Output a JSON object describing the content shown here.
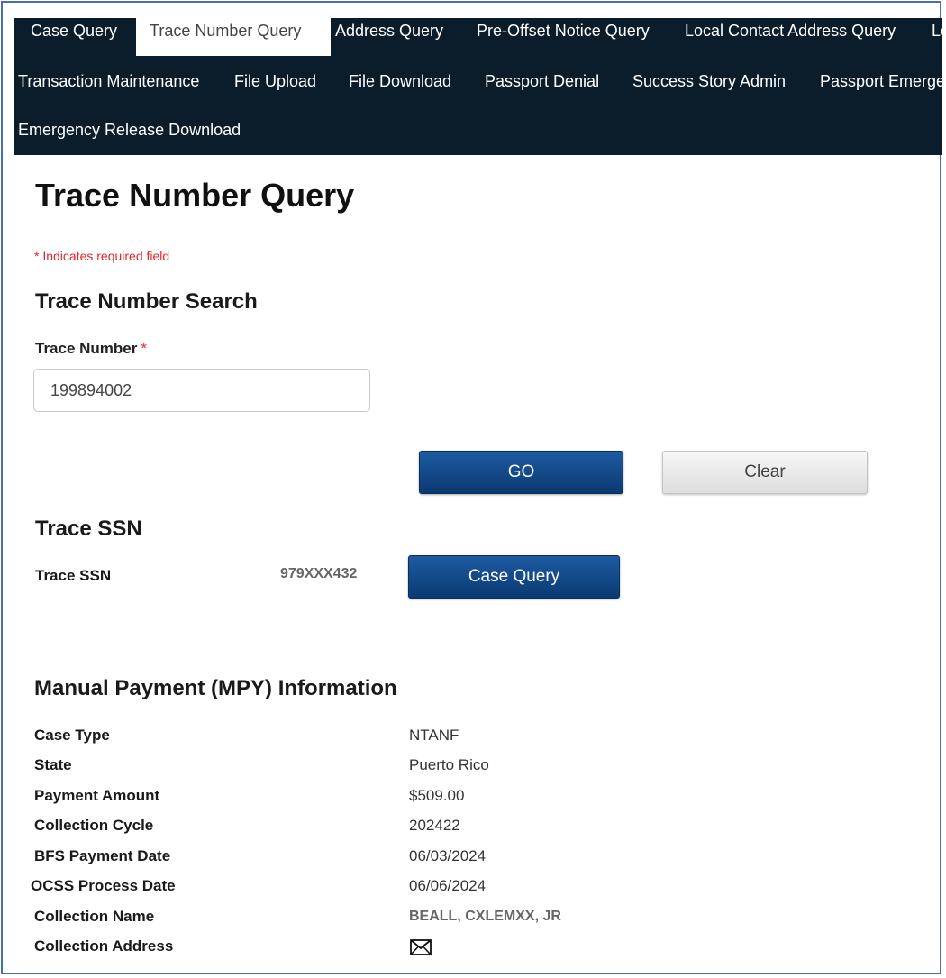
{
  "nav": {
    "row1": [
      "Case Query",
      "Trace Number Query",
      "Address Query",
      "Pre-Offset Notice Query",
      "Local Contact Address Query",
      "Lo"
    ],
    "row2": [
      "Transaction Maintenance",
      "File Upload",
      "File Download",
      "Passport Denial",
      "Success Story Admin",
      "Passport Emerge"
    ],
    "row3": [
      "Emergency Release Download"
    ],
    "active": "Trace Number Query"
  },
  "page": {
    "title": "Trace Number Query",
    "required_note": "* Indicates required field"
  },
  "search": {
    "section_title": "Trace Number Search",
    "field_label": "Trace Number",
    "required_marker": "*",
    "value": "199894002",
    "go_label": "GO",
    "clear_label": "Clear"
  },
  "trace_ssn": {
    "section_title": "Trace SSN",
    "label": "Trace SSN",
    "value": "979XXX432",
    "case_query_label": "Case Query"
  },
  "mpy": {
    "section_title": "Manual Payment (MPY) Information",
    "rows": [
      {
        "label": "Case Type",
        "value": "NTANF"
      },
      {
        "label": "State",
        "value": "Puerto Rico"
      },
      {
        "label": "Payment Amount",
        "value": "$509.00"
      },
      {
        "label": "Collection Cycle",
        "value": "202422"
      },
      {
        "label": "BFS Payment Date",
        "value": "06/03/2024"
      },
      {
        "label": "OCSS Process Date",
        "value": "06/06/2024"
      },
      {
        "label": "Collection Name",
        "value": "BEALL, CXLEMXX, JR"
      },
      {
        "label": "Collection Address",
        "value": ""
      }
    ],
    "address_icon": "envelope-icon"
  },
  "colors": {
    "nav_bg": "#0b1d2a",
    "primary_button": "#0b3a73",
    "required": "#e8232a"
  }
}
